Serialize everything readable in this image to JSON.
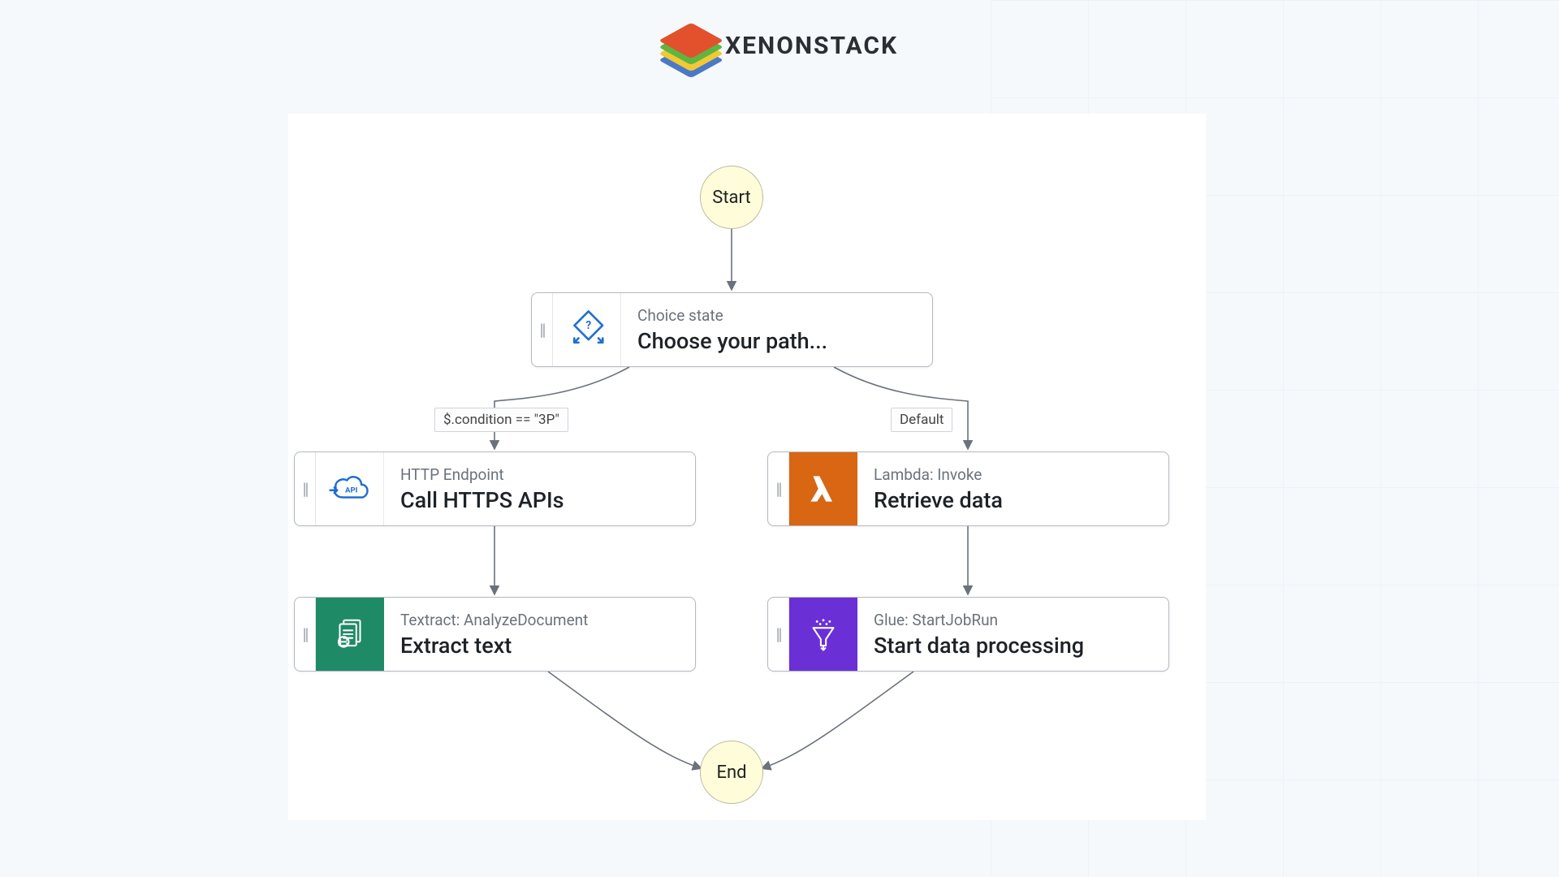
{
  "brand": {
    "name": "XENONSTACK"
  },
  "flow": {
    "start_label": "Start",
    "end_label": "End",
    "choice": {
      "type_label": "Choice state",
      "title": "Choose your path...",
      "icon": "choice-diamond-icon"
    },
    "branches": {
      "left_condition": "$.condition == \"3P\"",
      "right_condition": "Default"
    },
    "nodes": {
      "http": {
        "type_label": "HTTP Endpoint",
        "title": "Call HTTPS APIs",
        "icon": "api-cloud-icon",
        "icon_color": "#1f6fd0"
      },
      "lambda": {
        "type_label": "Lambda: Invoke",
        "title": "Retrieve data",
        "icon": "lambda-icon",
        "icon_bg": "#d86613"
      },
      "textract": {
        "type_label": "Textract: AnalyzeDocument",
        "title": "Extract text",
        "icon": "textract-icon",
        "icon_bg": "#1f8a66"
      },
      "glue": {
        "type_label": "Glue: StartJobRun",
        "title": "Start data processing",
        "icon": "glue-funnel-icon",
        "icon_bg": "#6b2fd6"
      }
    }
  }
}
